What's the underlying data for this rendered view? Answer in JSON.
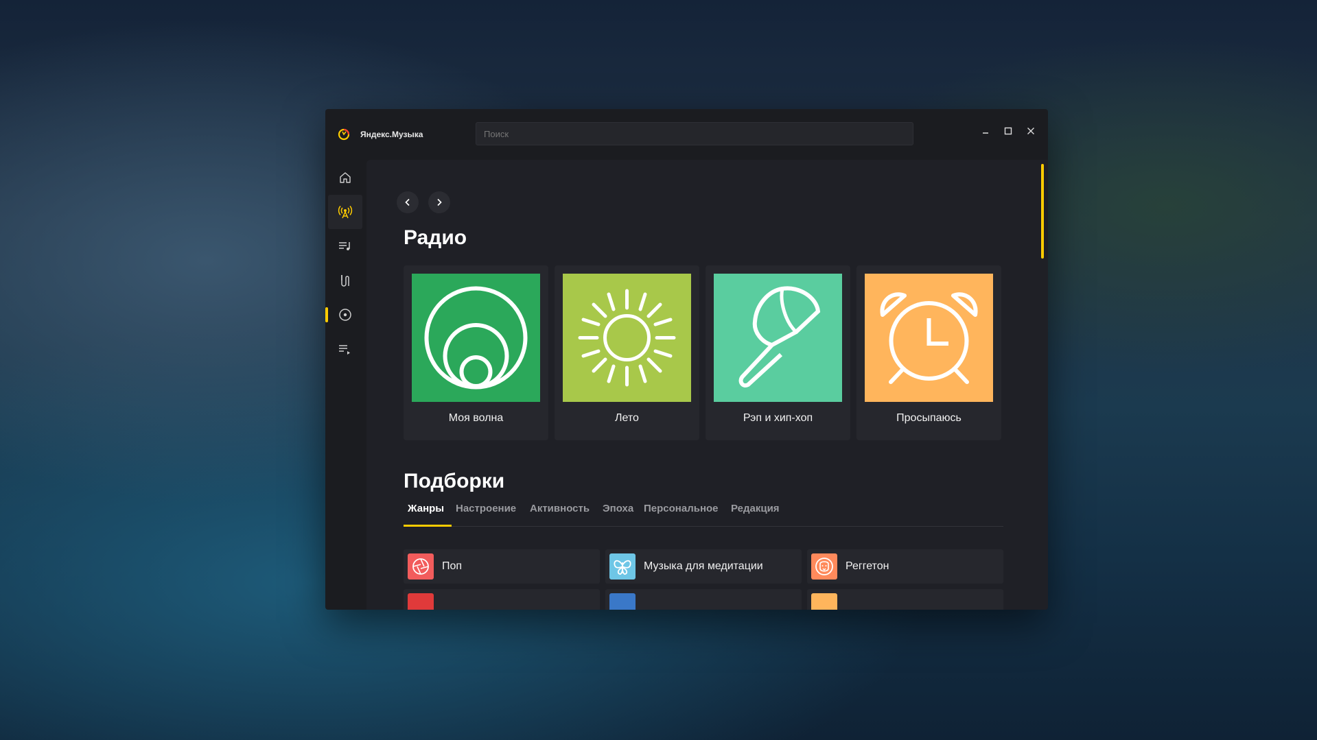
{
  "app": {
    "name": "Яндекс.Музыка"
  },
  "search": {
    "placeholder": "Поиск"
  },
  "window_controls": {
    "minimize": "–",
    "maximize": "☐",
    "close": "✕"
  },
  "sidebar": {
    "items": [
      {
        "icon": "home-icon",
        "active": false
      },
      {
        "icon": "radio-icon",
        "active": true
      },
      {
        "icon": "playlist-icon",
        "active": false
      },
      {
        "icon": "podcasts-icon",
        "active": false
      },
      {
        "icon": "disc-icon",
        "active": false
      },
      {
        "icon": "queue-icon",
        "active": false
      }
    ],
    "accent": "#ffcc00"
  },
  "radio": {
    "title": "Радио",
    "stations": [
      {
        "label": "Моя волна",
        "color": "#2ba85a",
        "icon": "wave-icon"
      },
      {
        "label": "Лето",
        "color": "#a8c84a",
        "icon": "sun-icon"
      },
      {
        "label": "Рэп и хип-хоп",
        "color": "#5acd9f",
        "icon": "cap-icon"
      },
      {
        "label": "Просыпаюсь",
        "color": "#ffb55c",
        "icon": "alarm-clock-icon"
      }
    ]
  },
  "collections": {
    "title": "Подборки",
    "tabs": [
      "Жанры",
      "Настроение",
      "Активность",
      "Эпоха",
      "Персональное",
      "Редакция"
    ],
    "active_tab": "Жанры",
    "genres": [
      {
        "name": "Поп",
        "color": "#f25c5c",
        "icon": "aperture-icon"
      },
      {
        "name": "Музыка для медитации",
        "color": "#6ec6e6",
        "icon": "butterfly-icon"
      },
      {
        "name": "Реггетон",
        "color": "#ff8a5c",
        "icon": "lion-icon"
      }
    ],
    "partial_row_colors": [
      "#e03a3a",
      "#3a78c8",
      "#ffb55c"
    ]
  }
}
